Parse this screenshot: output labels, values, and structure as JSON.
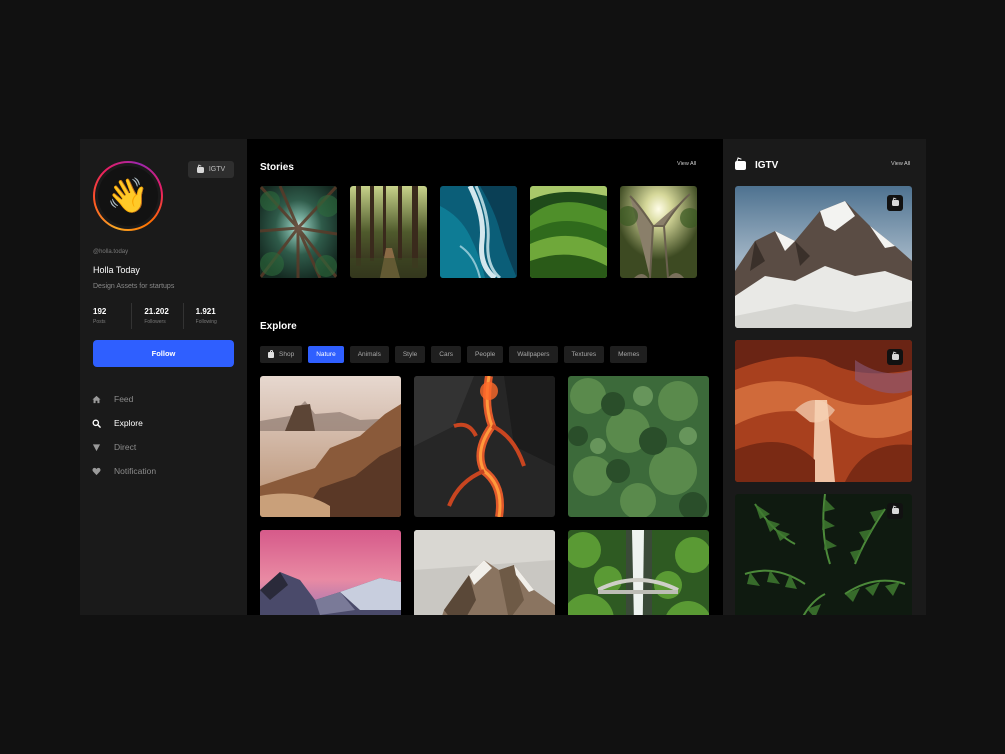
{
  "profile": {
    "avatar_emoji": "👋",
    "igtv_badge": "IGTV",
    "handle": "@holla.today",
    "name": "Holla Today",
    "description": "Design Assets for startups",
    "stats": [
      {
        "value": "192",
        "label": "Posts"
      },
      {
        "value": "21.202",
        "label": "Followers"
      },
      {
        "value": "1.921",
        "label": "Following"
      }
    ],
    "follow_label": "Follow"
  },
  "nav": [
    {
      "label": "Feed",
      "icon": "home-icon",
      "active": false
    },
    {
      "label": "Explore",
      "icon": "search-icon",
      "active": true
    },
    {
      "label": "Direct",
      "icon": "send-icon",
      "active": false
    },
    {
      "label": "Notification",
      "icon": "heart-icon",
      "active": false
    }
  ],
  "stories": {
    "title": "Stories",
    "view_all": "View All",
    "items": [
      "forest-canopy",
      "forest-path",
      "ocean-waves",
      "green-hills",
      "giant-tree"
    ]
  },
  "explore": {
    "title": "Explore",
    "chips": [
      {
        "label": "Shop",
        "icon": "shopping-bag-icon",
        "active": false
      },
      {
        "label": "Nature",
        "active": true
      },
      {
        "label": "Animals",
        "active": false
      },
      {
        "label": "Style",
        "active": false
      },
      {
        "label": "Cars",
        "active": false
      },
      {
        "label": "People",
        "active": false
      },
      {
        "label": "Wallpapers",
        "active": false
      },
      {
        "label": "Textures",
        "active": false
      },
      {
        "label": "Memes",
        "active": false
      }
    ],
    "tiles": [
      "desert-rocks",
      "lava-flow",
      "jungle-aerial",
      "sunset-mountains",
      "rocky-peak",
      "waterfall-bridge"
    ]
  },
  "igtv": {
    "title": "IGTV",
    "view_all": "View All",
    "cards": [
      "snowy-mountain",
      "canyon",
      "palm-leaves"
    ]
  },
  "colors": {
    "accent": "#2f5fff",
    "page_bg": "#111111",
    "panel_bg": "#1a1a1a",
    "main_bg": "#000000"
  }
}
